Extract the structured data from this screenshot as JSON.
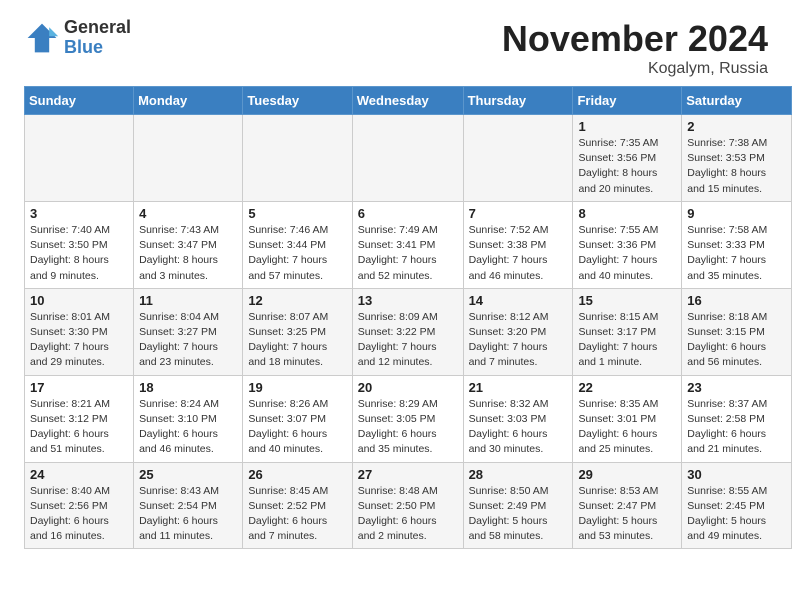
{
  "header": {
    "logo_general": "General",
    "logo_blue": "Blue",
    "month_title": "November 2024",
    "location": "Kogalym, Russia"
  },
  "weekdays": [
    "Sunday",
    "Monday",
    "Tuesday",
    "Wednesday",
    "Thursday",
    "Friday",
    "Saturday"
  ],
  "weeks": [
    [
      {
        "day": "",
        "detail": ""
      },
      {
        "day": "",
        "detail": ""
      },
      {
        "day": "",
        "detail": ""
      },
      {
        "day": "",
        "detail": ""
      },
      {
        "day": "",
        "detail": ""
      },
      {
        "day": "1",
        "detail": "Sunrise: 7:35 AM\nSunset: 3:56 PM\nDaylight: 8 hours\nand 20 minutes."
      },
      {
        "day": "2",
        "detail": "Sunrise: 7:38 AM\nSunset: 3:53 PM\nDaylight: 8 hours\nand 15 minutes."
      }
    ],
    [
      {
        "day": "3",
        "detail": "Sunrise: 7:40 AM\nSunset: 3:50 PM\nDaylight: 8 hours\nand 9 minutes."
      },
      {
        "day": "4",
        "detail": "Sunrise: 7:43 AM\nSunset: 3:47 PM\nDaylight: 8 hours\nand 3 minutes."
      },
      {
        "day": "5",
        "detail": "Sunrise: 7:46 AM\nSunset: 3:44 PM\nDaylight: 7 hours\nand 57 minutes."
      },
      {
        "day": "6",
        "detail": "Sunrise: 7:49 AM\nSunset: 3:41 PM\nDaylight: 7 hours\nand 52 minutes."
      },
      {
        "day": "7",
        "detail": "Sunrise: 7:52 AM\nSunset: 3:38 PM\nDaylight: 7 hours\nand 46 minutes."
      },
      {
        "day": "8",
        "detail": "Sunrise: 7:55 AM\nSunset: 3:36 PM\nDaylight: 7 hours\nand 40 minutes."
      },
      {
        "day": "9",
        "detail": "Sunrise: 7:58 AM\nSunset: 3:33 PM\nDaylight: 7 hours\nand 35 minutes."
      }
    ],
    [
      {
        "day": "10",
        "detail": "Sunrise: 8:01 AM\nSunset: 3:30 PM\nDaylight: 7 hours\nand 29 minutes."
      },
      {
        "day": "11",
        "detail": "Sunrise: 8:04 AM\nSunset: 3:27 PM\nDaylight: 7 hours\nand 23 minutes."
      },
      {
        "day": "12",
        "detail": "Sunrise: 8:07 AM\nSunset: 3:25 PM\nDaylight: 7 hours\nand 18 minutes."
      },
      {
        "day": "13",
        "detail": "Sunrise: 8:09 AM\nSunset: 3:22 PM\nDaylight: 7 hours\nand 12 minutes."
      },
      {
        "day": "14",
        "detail": "Sunrise: 8:12 AM\nSunset: 3:20 PM\nDaylight: 7 hours\nand 7 minutes."
      },
      {
        "day": "15",
        "detail": "Sunrise: 8:15 AM\nSunset: 3:17 PM\nDaylight: 7 hours\nand 1 minute."
      },
      {
        "day": "16",
        "detail": "Sunrise: 8:18 AM\nSunset: 3:15 PM\nDaylight: 6 hours\nand 56 minutes."
      }
    ],
    [
      {
        "day": "17",
        "detail": "Sunrise: 8:21 AM\nSunset: 3:12 PM\nDaylight: 6 hours\nand 51 minutes."
      },
      {
        "day": "18",
        "detail": "Sunrise: 8:24 AM\nSunset: 3:10 PM\nDaylight: 6 hours\nand 46 minutes."
      },
      {
        "day": "19",
        "detail": "Sunrise: 8:26 AM\nSunset: 3:07 PM\nDaylight: 6 hours\nand 40 minutes."
      },
      {
        "day": "20",
        "detail": "Sunrise: 8:29 AM\nSunset: 3:05 PM\nDaylight: 6 hours\nand 35 minutes."
      },
      {
        "day": "21",
        "detail": "Sunrise: 8:32 AM\nSunset: 3:03 PM\nDaylight: 6 hours\nand 30 minutes."
      },
      {
        "day": "22",
        "detail": "Sunrise: 8:35 AM\nSunset: 3:01 PM\nDaylight: 6 hours\nand 25 minutes."
      },
      {
        "day": "23",
        "detail": "Sunrise: 8:37 AM\nSunset: 2:58 PM\nDaylight: 6 hours\nand 21 minutes."
      }
    ],
    [
      {
        "day": "24",
        "detail": "Sunrise: 8:40 AM\nSunset: 2:56 PM\nDaylight: 6 hours\nand 16 minutes."
      },
      {
        "day": "25",
        "detail": "Sunrise: 8:43 AM\nSunset: 2:54 PM\nDaylight: 6 hours\nand 11 minutes."
      },
      {
        "day": "26",
        "detail": "Sunrise: 8:45 AM\nSunset: 2:52 PM\nDaylight: 6 hours\nand 7 minutes."
      },
      {
        "day": "27",
        "detail": "Sunrise: 8:48 AM\nSunset: 2:50 PM\nDaylight: 6 hours\nand 2 minutes."
      },
      {
        "day": "28",
        "detail": "Sunrise: 8:50 AM\nSunset: 2:49 PM\nDaylight: 5 hours\nand 58 minutes."
      },
      {
        "day": "29",
        "detail": "Sunrise: 8:53 AM\nSunset: 2:47 PM\nDaylight: 5 hours\nand 53 minutes."
      },
      {
        "day": "30",
        "detail": "Sunrise: 8:55 AM\nSunset: 2:45 PM\nDaylight: 5 hours\nand 49 minutes."
      }
    ]
  ]
}
